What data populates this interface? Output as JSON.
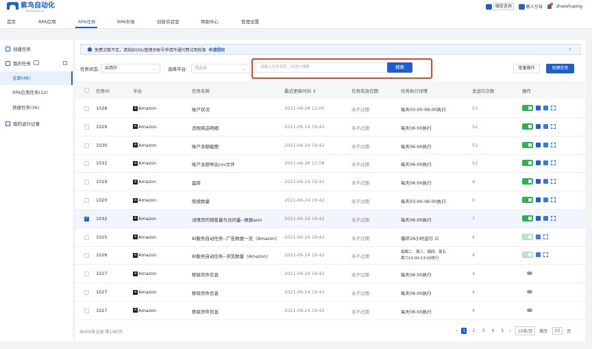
{
  "header": {
    "logo_text": "紫鸟自动化",
    "logo_sub": "跨境电商自动化平台",
    "nav": [
      "首页",
      "RPA应用",
      "RPA任务",
      "RPA市场",
      "创新实验室",
      "帮助中心",
      "管理设置"
    ],
    "active_nav": "RPA任务",
    "wechat": "微信咨询",
    "guide": "新人引导",
    "user": "zhaoshuping"
  },
  "sidebar": {
    "create": "创建任务",
    "my_tasks": "我的任务",
    "subs": [
      "全部(48)",
      "RPA应用任务(12)",
      "快捷任务(36)"
    ],
    "runs": "我的运行记录"
  },
  "notice": {
    "text": "免费次数不足，请找BOSS/管理员账号申请开通付费试用权限",
    "link": "申请授权",
    "close": "×"
  },
  "filters": {
    "status_label": "任务状态:",
    "status_value": "启用中",
    "platform_label": "选择平台:",
    "platform_placeholder": "请选择",
    "search_placeholder": "请输入任务名称、ID进行搜索",
    "search_btn": "搜索",
    "batch_btn": "批量操作",
    "create_btn": "创建任务"
  },
  "table": {
    "headers": [
      "任务ID",
      "平台",
      "任务名称",
      "最近更新时间 ↕",
      "任务有效日期",
      "任务执行详情",
      "总运行次数",
      "操作"
    ],
    "rows": [
      {
        "id": "1028",
        "platform": "Amazon",
        "name": "账户状况",
        "updated": "2021-06-28  12:00",
        "valid": "永不过期",
        "detail": "每天03:00-06:00执行",
        "runs": "53",
        "act": "full"
      },
      {
        "id": "1029",
        "platform": "Amazon",
        "name": "违规商品明细",
        "updated": "2021-06-24  19:42",
        "valid": "永不过期",
        "detail": "每天06:00执行",
        "runs": "52",
        "act": "full"
      },
      {
        "id": "1030",
        "platform": "Amazon",
        "name": "账户余额截图",
        "updated": "2021-06-24  19:42",
        "valid": "永不过期",
        "detail": "每天06:00执行",
        "runs": "52",
        "act": "full"
      },
      {
        "id": "1031",
        "platform": "Amazon",
        "name": "账户余额导出csv文件",
        "updated": "2021-06-28  12:08",
        "valid": "永不过期",
        "detail": "每天06:00执行",
        "runs": "52",
        "act": "full"
      },
      {
        "id": "1019",
        "platform": "Amazon",
        "name": "盘库",
        "updated": "2021-06-24 19:42",
        "valid": "永不过期",
        "detail": "每天06:00执行",
        "runs": "9",
        "act": "full"
      },
      {
        "id": "1020",
        "platform": "Amazon",
        "name": "赔偿数量",
        "updated": "2021-06-24 19:42",
        "valid": "永不过期",
        "detail": "每天03:00-06:00执行",
        "runs": "0",
        "act": "full"
      },
      {
        "id": "1032",
        "platform": "Amazon",
        "name": "详情页的销售量与访问量--根据asin",
        "updated": "2021-06-24 19:42",
        "valid": "永不过期",
        "detail": "每天06:00执行",
        "runs": "7",
        "act": "full",
        "selected": true
      },
      {
        "id": "1025",
        "platform": "Amazon",
        "name": "BI服务自动任务--广告数据一览（Amazon）",
        "updated": "2021-06-24 19:42",
        "valid": "永不过期",
        "detail": "循环26小时运行 ☑",
        "runs": "4",
        "act": "light"
      },
      {
        "id": "1026",
        "platform": "Amazon",
        "name": "BI服务自动任务--浏览数量（Amazon）",
        "updated": "2021-06-24 19:42",
        "valid": "永不过期",
        "detail": "每周二、周三、周四、周五",
        "detail2": "周六10:00-13:00执行",
        "runs": "4",
        "act": "light"
      },
      {
        "id": "1027",
        "platform": "Amazon",
        "name": "移除货件信息",
        "updated": "2021-06-24 19:42",
        "valid": "永不过期",
        "detail": "每天06:00执行",
        "runs": "4",
        "act": "pill"
      },
      {
        "id": "1027",
        "platform": "Amazon",
        "name": "移除货件信息",
        "updated": "2021-06-24 19:42",
        "valid": "永不过期",
        "detail": "每天06:00执行",
        "runs": "4",
        "act": "pill"
      },
      {
        "id": "1027",
        "platform": "Amazon",
        "name": "移除货件信息",
        "updated": "2021-06-24 19:42",
        "valid": "永不过期",
        "detail": "每天06:00执行",
        "runs": "4",
        "act": "pill"
      }
    ]
  },
  "footer": {
    "summary": "共400条记录 第1/80页",
    "pages": [
      "1",
      "2",
      "3",
      "4",
      "5"
    ],
    "per_page": "10条/页",
    "goto": "跳至",
    "goto_value": "10",
    "page_unit": "页"
  }
}
